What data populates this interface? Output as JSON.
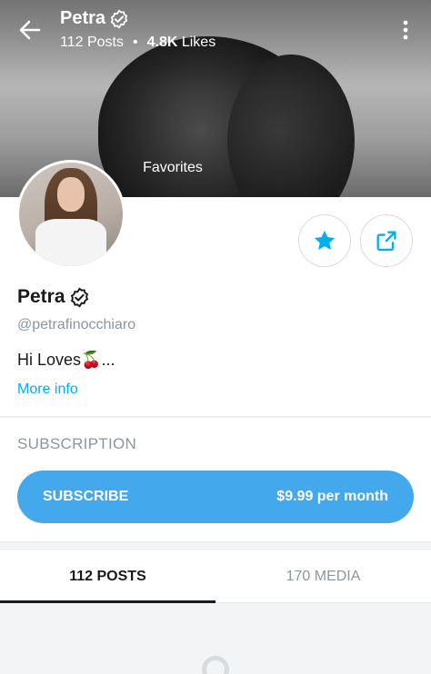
{
  "header": {
    "name": "Petra",
    "posts_count": "112",
    "posts_label": "Posts",
    "likes_count": "4.8K",
    "likes_label": "Likes",
    "separator": "•"
  },
  "cover": {
    "favorites_label": "Favorites"
  },
  "profile": {
    "name": "Petra",
    "handle": "@petrafinocchiaro",
    "bio": "Hi Loves🍒...",
    "more_info_label": "More info"
  },
  "subscription": {
    "section_title": "SUBSCRIPTION",
    "button_label": "SUBSCRIBE",
    "price": "$9.99 per month"
  },
  "tabs": [
    {
      "label": "112 POSTS",
      "active": true
    },
    {
      "label": "170 MEDIA",
      "active": false
    }
  ],
  "colors": {
    "accent": "#00aff0",
    "subscribe_button": "#44a8ec",
    "muted_text": "#8a96a3"
  },
  "icons": [
    "back-arrow-icon",
    "verified-badge-icon",
    "more-vertical-icon",
    "star-icon",
    "share-icon"
  ]
}
